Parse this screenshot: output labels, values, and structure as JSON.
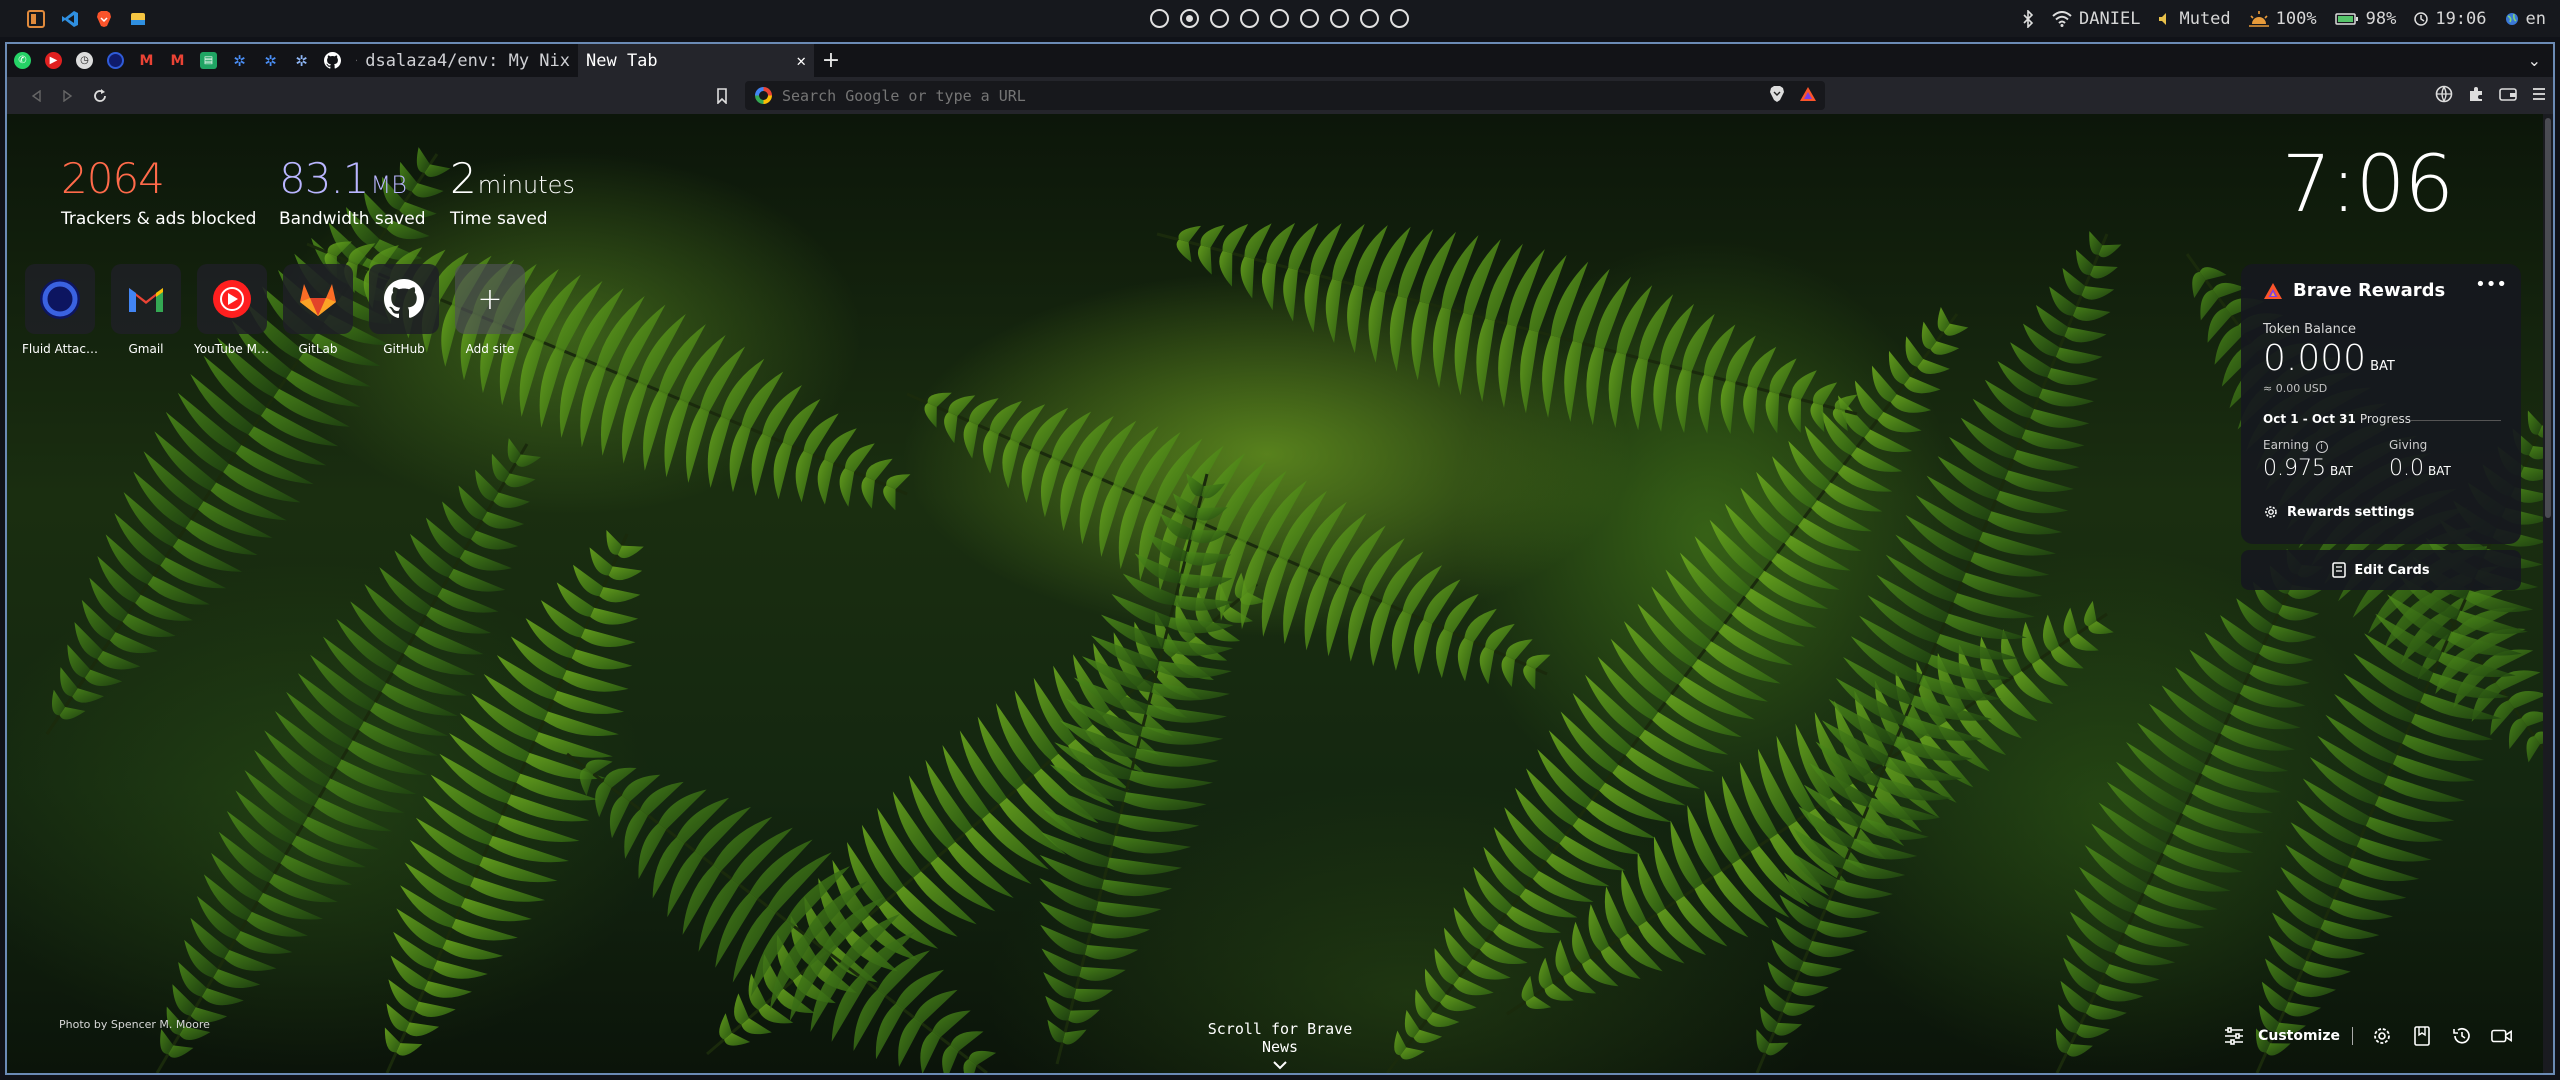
{
  "system_bar": {
    "left_icons": [
      "files-icon",
      "vscode-icon",
      "brave-icon",
      "drive-icon"
    ],
    "workspaces": [
      {
        "active": false
      },
      {
        "active": true
      },
      {
        "active": false
      },
      {
        "active": false
      },
      {
        "active": false
      },
      {
        "active": false
      },
      {
        "active": false
      },
      {
        "active": false
      },
      {
        "active": false
      }
    ],
    "user": "DANIEL",
    "volume": "Muted",
    "brightness": "100%",
    "battery": "98%",
    "time": "19:06",
    "language": "en"
  },
  "tabs": {
    "github_tab_title": "dsalaza4/env: My Nix",
    "active_tab_title": "New Tab"
  },
  "toolbar": {
    "url_placeholder": "Search Google or type a URL"
  },
  "stats": {
    "trackers_value": "2064",
    "trackers_label": "Trackers & ads blocked",
    "bandwidth_value": "83.1",
    "bandwidth_unit": "MB",
    "bandwidth_label": "Bandwidth saved",
    "time_value": "2",
    "time_unit": "minutes",
    "time_label": "Time saved"
  },
  "clock": "7:06",
  "top_sites": [
    {
      "name": "Fluid Attacks"
    },
    {
      "name": "Gmail"
    },
    {
      "name": "YouTube Mu..."
    },
    {
      "name": "GitLab"
    },
    {
      "name": "GitHub"
    },
    {
      "name": "Add site"
    }
  ],
  "rewards": {
    "title": "Brave Rewards",
    "token_balance_label": "Token Balance",
    "balance": "0.000",
    "currency": "BAT",
    "usd": "≈ 0.00 USD",
    "period": "Oct 1 - Oct 31",
    "progress_label": "Progress",
    "earning_label": "Earning",
    "earning_value": "0.975",
    "giving_label": "Giving",
    "giving_value": "0.0",
    "settings_label": "Rewards settings",
    "edit_cards_label": "Edit Cards"
  },
  "photo_credit": "Photo by Spencer M. Moore",
  "brave_news_label": "Scroll for Brave News",
  "customize_label": "Customize",
  "colors": {
    "trackers": "#ff6a4a",
    "bandwidth": "#b9b5ff",
    "brave_orange": "#fb542b",
    "window_border": "#6b8bb5"
  }
}
